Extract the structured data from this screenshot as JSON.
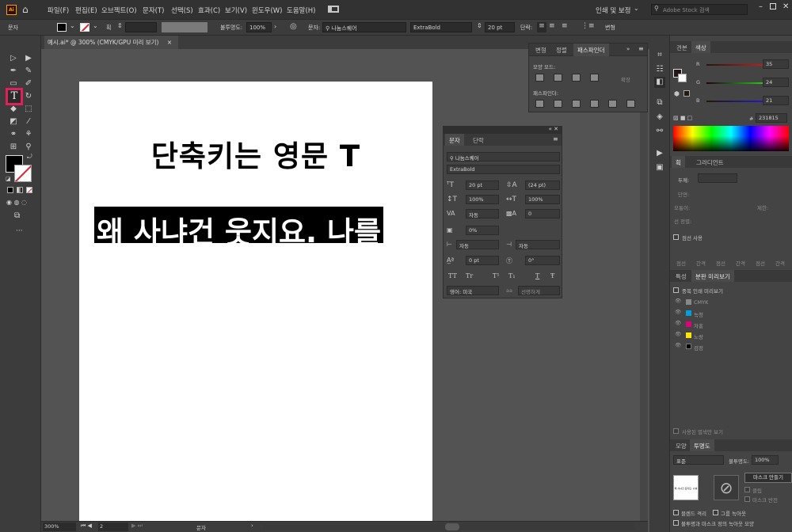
{
  "menubar": {
    "logo": "Ai",
    "items": [
      "파일(F)",
      "편집(E)",
      "오브젝트(O)",
      "문자(T)",
      "선택(S)",
      "효과(C)",
      "보기(V)",
      "윈도우(W)",
      "도움말(H)"
    ],
    "workspace": "인쇄 및 보정",
    "search_placeholder": "Adobe Stock 검색"
  },
  "control": {
    "label": "문자",
    "stroke_label": "획",
    "opacity_label": "불투명도:",
    "opacity_value": "100%",
    "char_label": "문자:",
    "font": "나눔스퀘어",
    "style": "ExtraBold",
    "size": "20 pt",
    "para_label": "단락:",
    "transform_label": "변형"
  },
  "doc_tab": {
    "title": "예시.ai* @ 300% (CMYK/GPU 미리 보기)",
    "close": "×"
  },
  "artboard": {
    "line1": "단축키는 영문 T",
    "line2": "왜 사냐건 웃지요. 나를"
  },
  "status": {
    "zoom": "300%",
    "page": "2",
    "tool": "문자"
  },
  "pathfinder": {
    "tabs": [
      "변형",
      "정렬",
      "패스파인더"
    ],
    "shape_modes": "모양 모드:",
    "expand": "확장",
    "pathfinders": "패스파인더:"
  },
  "character": {
    "tabs": [
      "문자",
      "단락"
    ],
    "font": "나눔스퀘어",
    "style": "ExtraBold",
    "size": "20 pt",
    "leading": "(24 pt)",
    "vscale": "100%",
    "hscale": "100%",
    "kerning": "자동",
    "tracking": "0",
    "tsume": "0%",
    "aki_left": "자동",
    "aki_right": "자동",
    "baseline": "0 pt",
    "rotate": "0°",
    "lang": "영어: 미국",
    "aa": "선명하게",
    "caps": [
      "TT",
      "Tr",
      "T¹",
      "T₁",
      "T",
      "Ŧ"
    ]
  },
  "color": {
    "tabs": [
      "견본",
      "색상"
    ],
    "channels": [
      {
        "label": "R",
        "value": "35"
      },
      {
        "label": "G",
        "value": "24"
      },
      {
        "label": "B",
        "value": "21"
      }
    ],
    "hex_label": "#",
    "hex": "231815"
  },
  "stroke_panel": {
    "tabs": [
      "획",
      "그라디언트"
    ],
    "weight_label": "두께:",
    "cap": "단면:",
    "corner": "모퉁이:",
    "align": "선 정렬:",
    "limit": "제한:",
    "dash_label": "점선 사용",
    "dash_cells": [
      "점선",
      "간격",
      "점선",
      "간격",
      "점선",
      "간격"
    ]
  },
  "preview": {
    "tabs": [
      "특성",
      "분판 미리보기"
    ],
    "overprint": "중복 인쇄 미리보기",
    "inks": [
      {
        "name": "CMYK",
        "color": "#888888"
      },
      {
        "name": "녹청",
        "color": "#00a0e0"
      },
      {
        "name": "자홍",
        "color": "#e0007a"
      },
      {
        "name": "노랑",
        "color": "#ffe600"
      },
      {
        "name": "검정",
        "color": "#000000"
      }
    ],
    "used_only": "사용된 별색만 보기"
  },
  "transparency": {
    "tabs": [
      "모양",
      "투명도"
    ],
    "blend": "표준",
    "opacity_label": "불투명도:",
    "opacity": "100%",
    "thumb_text": "왜 사냐건 웃지요. 나를",
    "make_mask": "마스크 만들기",
    "clip": "클립",
    "invert": "마스크 반전",
    "iso": "블렌드 격리",
    "knockout": "그룹 녹아웃",
    "alpha_knockout": "불투명과 마스크 정의 녹아웃 모양"
  }
}
